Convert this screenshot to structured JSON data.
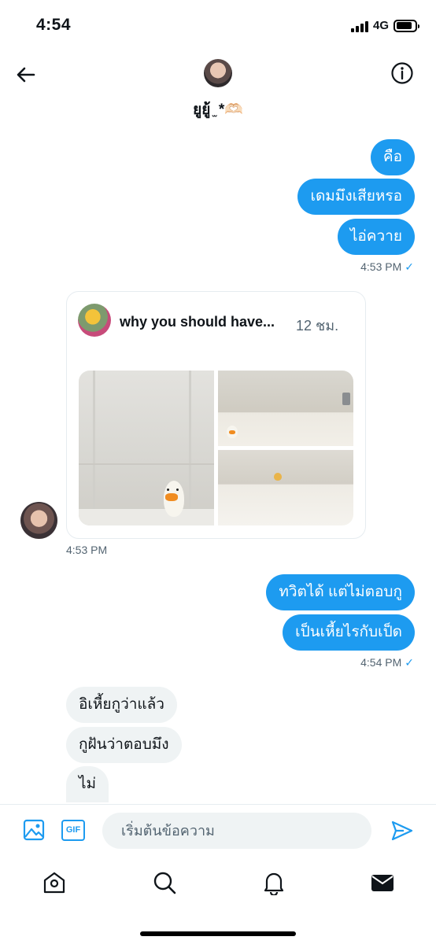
{
  "status_bar": {
    "time": "4:54",
    "network": "4G"
  },
  "header": {
    "contact_name": "ยูยู้ ̫ *🫶🏻",
    "back_icon": "arrow-left-icon",
    "info_icon": "info-icon"
  },
  "messages": {
    "group1": [
      "คือ",
      "เดมมึงเสียหรอ",
      "ไอ่ควาย"
    ],
    "group1_time": "4:53 PM",
    "tweet": {
      "author": "why you should have...",
      "time": "12 ชม."
    },
    "tweet_time": "4:53 PM",
    "group2": [
      "ทวิตได้ แต่ไม่ตอบกู",
      "เป็นเหี้ยไรกับเป็ด"
    ],
    "group2_time": "4:54 PM",
    "incoming": [
      "อิเหี้ยกูว่าแล้ว",
      "กูฝันว่าตอบมึง",
      "ไม่"
    ],
    "read_mark": "✓"
  },
  "composer": {
    "placeholder": "เริ่มต้นข้อความ",
    "gif_label": "GIF"
  },
  "tabs": [
    "home-icon",
    "search-icon",
    "bell-icon",
    "mail-icon"
  ],
  "colors": {
    "accent": "#1d9bf0",
    "incoming_bubble": "#eff3f4",
    "secondary_text": "#536471"
  }
}
